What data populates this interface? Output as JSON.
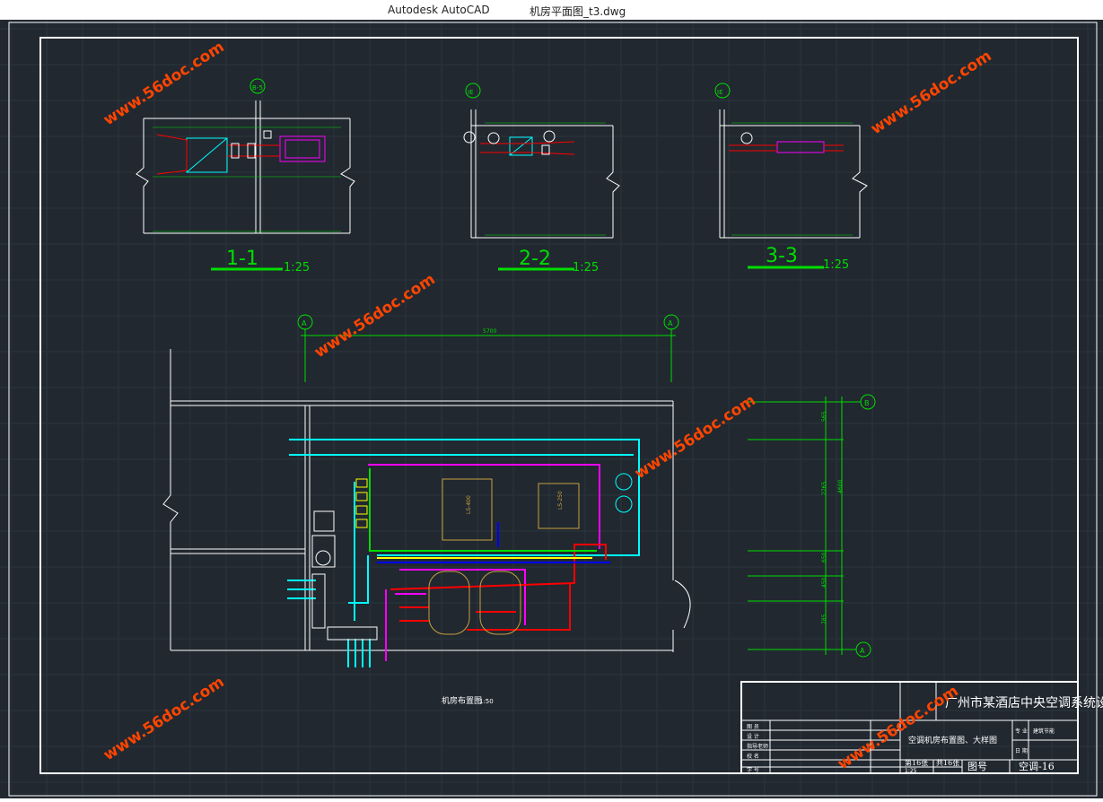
{
  "window": {
    "app_title": "Autodesk AutoCAD",
    "file_name": "机房平面图_t3.dwg"
  },
  "watermark": "www.56doc.com",
  "sections": [
    {
      "name": "1-1",
      "scale": "1:25",
      "axis": "B-5"
    },
    {
      "name": "2-2",
      "scale": "1:25",
      "axis": "IE"
    },
    {
      "name": "3-3",
      "scale": "1:25",
      "axis": "IE"
    }
  ],
  "plan": {
    "axis_a": "A",
    "axis_b": "B",
    "dim_total": "5700",
    "dim_vertical_total": "4600",
    "dims_vertical": [
      "565",
      "2765",
      "650",
      "450",
      "785"
    ],
    "unit_left": "LS-400",
    "unit_right": "LS-250",
    "title": "机房布置图",
    "title_scale": "1:50"
  },
  "title_block": {
    "project": "广州市某酒店中央空调系统设计",
    "drawing_name": "空调机房布置图、大样图",
    "left_labels": [
      "图  员",
      "设  计",
      "指导老师",
      "校  名",
      "学  号"
    ],
    "specialty_label": "专 业",
    "specialty_value": "建筑节能",
    "date_label": "日 期",
    "sheet_label": "第16张",
    "total_label": "共16张",
    "scale_value": "1:25",
    "drawing_no_label": "图号",
    "drawing_no_value": "空调-16"
  },
  "colors": {
    "background": "#212830",
    "frame": "#ffffff",
    "dimension": "#00dd00",
    "chilled_water": "#00ffff",
    "hot_water": "#ff0000",
    "cooling_water": "#ff00ff",
    "condensate": "#ffff00",
    "supply": "#0000ff",
    "equipment": "#c8a040",
    "watermark": "#ff4500"
  }
}
